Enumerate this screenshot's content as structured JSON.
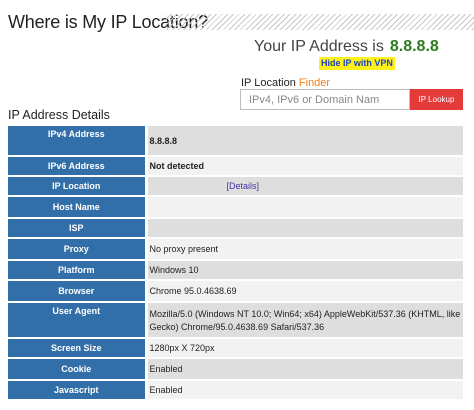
{
  "header": {
    "title": "Where is My IP Location?"
  },
  "ip_summary": {
    "label": "Your IP Address is",
    "ip": "8.8.8.8",
    "hide_link": "Hide IP with VPN"
  },
  "finder": {
    "label_main": "IP Location",
    "label_accent": "Finder",
    "input_placeholder": "IPv4, IPv6 or Domain Nam",
    "input_value": "",
    "button_label": "IP Lookup"
  },
  "details": {
    "title": "IP Address Details",
    "link_label": "[Details]",
    "rows": [
      {
        "label": "IPv4 Address",
        "value": "8.8.8.8"
      },
      {
        "label": "IPv6 Address",
        "value": "Not detected"
      },
      {
        "label": "IP Location",
        "value": ""
      },
      {
        "label": "Host Name",
        "value": ""
      },
      {
        "label": "ISP",
        "value": ""
      },
      {
        "label": "Proxy",
        "value": "No proxy present"
      },
      {
        "label": "Platform",
        "value": "Windows 10"
      },
      {
        "label": "Browser",
        "value": "Chrome 95.0.4638.69"
      },
      {
        "label": "User Agent",
        "value": "Mozilla/5.0 (Windows NT 10.0; Win64; x64) AppleWebKit/537.36 (KHTML, like Gecko) Chrome/95.0.4638.69 Safari/537.36"
      },
      {
        "label": "Screen Size",
        "value": "1280px X 720px"
      },
      {
        "label": "Cookie",
        "value": "Enabled"
      },
      {
        "label": "Javascript",
        "value": "Enabled"
      }
    ]
  },
  "colors": {
    "label_bg": "#326fa8",
    "ip_green": "#2e7d1f",
    "finder_accent": "#ef7d1a",
    "lookup_button": "#e33a3a",
    "hide_ip_bg": "#fff21a"
  }
}
